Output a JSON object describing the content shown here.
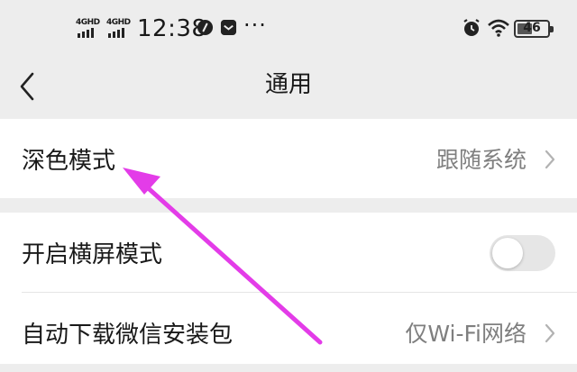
{
  "status_bar": {
    "signal_1_label": "4GHD",
    "signal_2_label": "4GHD",
    "time": "12:38",
    "more": "···",
    "battery": "46",
    "icons": [
      "signal-icon",
      "signal-icon",
      "music-app-icon",
      "message-app-icon",
      "alarm-icon",
      "wifi-icon",
      "battery-icon"
    ]
  },
  "nav": {
    "title": "通用",
    "back_icon": "chevron-left-icon"
  },
  "settings": {
    "dark_mode": {
      "label": "深色模式",
      "value": "跟随系统"
    },
    "landscape": {
      "label": "开启横屏模式",
      "enabled": false
    },
    "auto_download": {
      "label": "自动下载微信安装包",
      "value": "仅Wi-Fi网络"
    }
  },
  "annotation": {
    "arrow_color": "#e33ce8"
  }
}
